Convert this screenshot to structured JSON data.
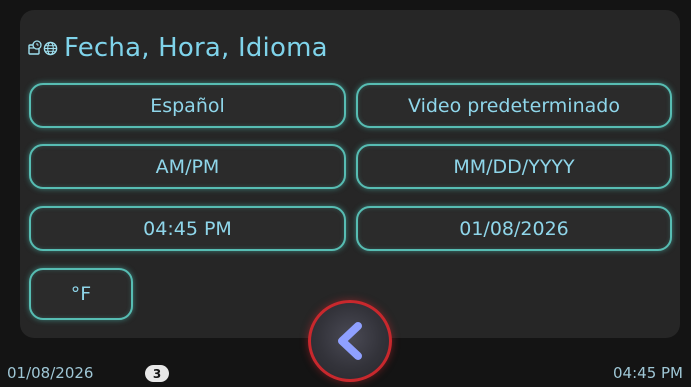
{
  "header": {
    "title": "Fecha, Hora, Idioma",
    "icons": [
      "clock-calendar-icon",
      "globe-icon"
    ]
  },
  "settings": {
    "language": "Español",
    "default_video": "Video predeterminado",
    "time_format": "AM/PM",
    "date_format": "MM/DD/YYYY",
    "time_value": "04:45 PM",
    "date_value": "01/08/2026",
    "temperature_unit": "°F"
  },
  "navigation": {
    "back_icon": "chevron-left-icon"
  },
  "status_bar": {
    "date": "01/08/2026",
    "badge_count": "3",
    "time": "04:45 PM"
  },
  "colors": {
    "accent_text": "#7fd3ea",
    "button_border": "#57bdb3",
    "back_button_ring": "#c8282d",
    "back_arrow": "#8fa0ff"
  }
}
